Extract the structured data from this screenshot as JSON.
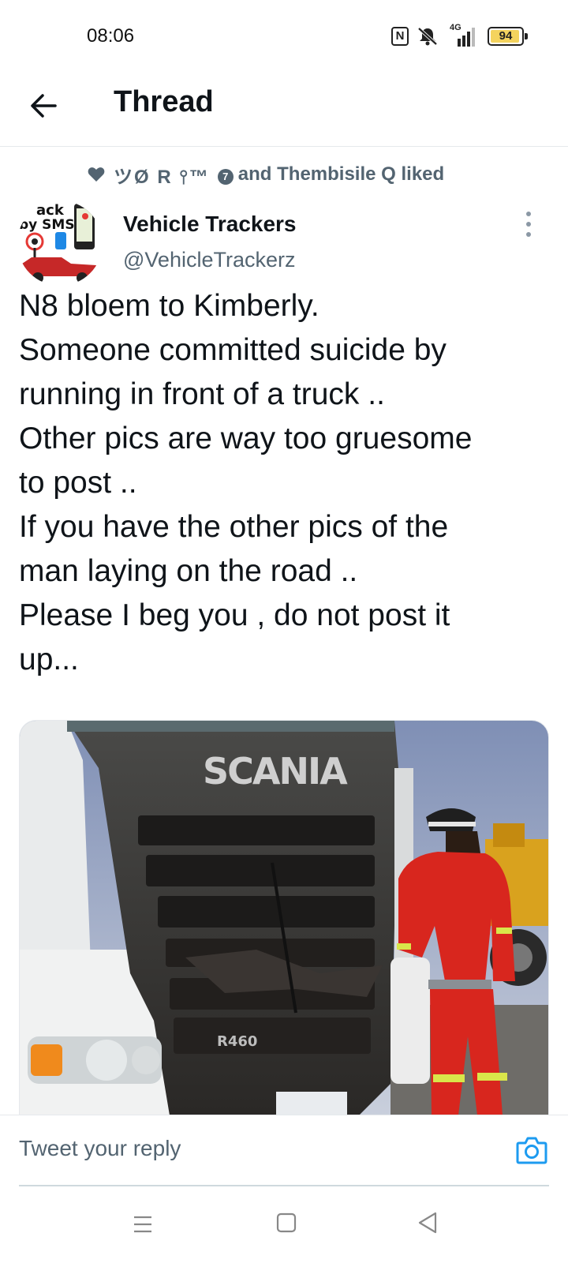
{
  "status_bar": {
    "time": "08:06",
    "network": "4G",
    "battery": "94",
    "battery_level": 0.94
  },
  "header": {
    "title": "Thread"
  },
  "social_context": {
    "name": "ツØ R ⫯™",
    "badge": "7",
    "suffix": "and Thembisile Q liked"
  },
  "tweet": {
    "author_name": "Vehicle Trackers",
    "author_handle": "@VehicleTrackerz",
    "avatar_text_1": "ack",
    "avatar_text_2": "by SMS",
    "lines": [
      "N8 bloem to Kimberly.",
      "Someone committed suicide by",
      "running in front of a truck ..",
      "Other pics are way too gruesome",
      "to post ..",
      "If you have the other pics of the",
      "man laying on the road ..",
      "Please I beg you , do not post it",
      "up..."
    ],
    "media": {
      "brand_text": "SCANIA",
      "model_text": "R460"
    }
  },
  "reply": {
    "placeholder": "Tweet your reply"
  },
  "colors": {
    "text_primary": "#0f1419",
    "text_secondary": "#536471",
    "accent": "#1d9bf0",
    "divider": "#e6e9ec"
  }
}
